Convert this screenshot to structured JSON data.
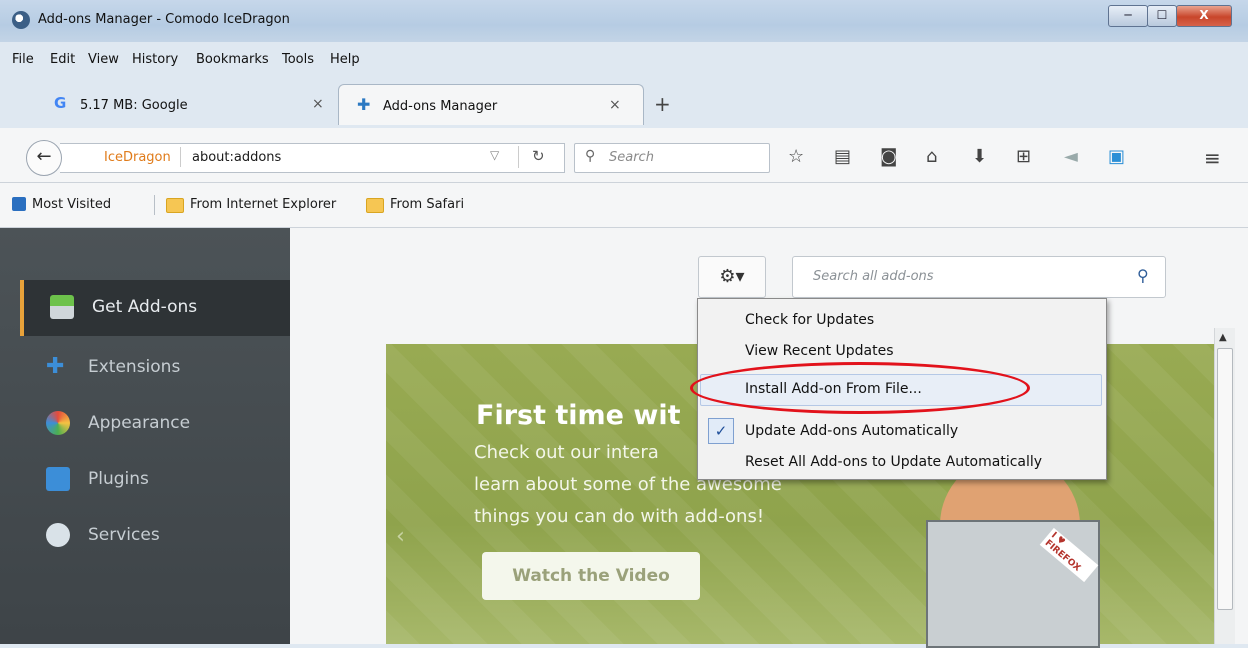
{
  "window": {
    "title": "Add-ons Manager - Comodo IceDragon",
    "minimize": "─",
    "maximize": "☐",
    "close": "X"
  },
  "menubar": [
    "File",
    "Edit",
    "View",
    "History",
    "Bookmarks",
    "Tools",
    "Help"
  ],
  "tabs": [
    {
      "label": "5.17 MB: Google",
      "close": "×",
      "active": false
    },
    {
      "label": "Add-ons Manager",
      "close": "×",
      "active": true
    }
  ],
  "new_tab": "+",
  "navbar": {
    "identity_label": "IceDragon",
    "url": "about:addons",
    "search_placeholder": "Search"
  },
  "bookmarks": [
    {
      "label": "Most Visited",
      "icon": "most-visited-icon"
    },
    {
      "label": "From Internet Explorer",
      "icon": "folder-icon"
    },
    {
      "label": "From Safari",
      "icon": "folder-icon"
    }
  ],
  "sidebar": {
    "items": [
      {
        "label": "Get Add-ons",
        "icon": "get-addons-icon",
        "selected": true
      },
      {
        "label": "Extensions",
        "icon": "puzzle-icon",
        "selected": false
      },
      {
        "label": "Appearance",
        "icon": "palette-icon",
        "selected": false
      },
      {
        "label": "Plugins",
        "icon": "plugin-icon",
        "selected": false
      },
      {
        "label": "Services",
        "icon": "chat-icon",
        "selected": false
      }
    ]
  },
  "addons": {
    "search_placeholder": "Search all add-ons"
  },
  "gear_menu": {
    "items": [
      {
        "label": "Check for Updates",
        "checked": false
      },
      {
        "label": "View Recent Updates",
        "checked": false
      },
      {
        "label": "Install Add-on From File...",
        "checked": false,
        "highlighted": true
      },
      {
        "label": "Update Add-ons Automatically",
        "checked": true
      },
      {
        "label": "Reset All Add-ons to Update Automatically",
        "checked": false
      }
    ]
  },
  "banner": {
    "title": "First time wit",
    "lines": [
      "Check out our intera",
      "learn about some of the awesome",
      "things you can do with add-ons!"
    ],
    "button": "Watch the Video",
    "sticker": "I ♥ FIREFOX"
  },
  "colors": {
    "sidebar_bg": "#3e4448",
    "selected_accent": "#e8a23a",
    "banner_bg": "#98aa52",
    "highlight_ellipse": "#e2121b"
  }
}
